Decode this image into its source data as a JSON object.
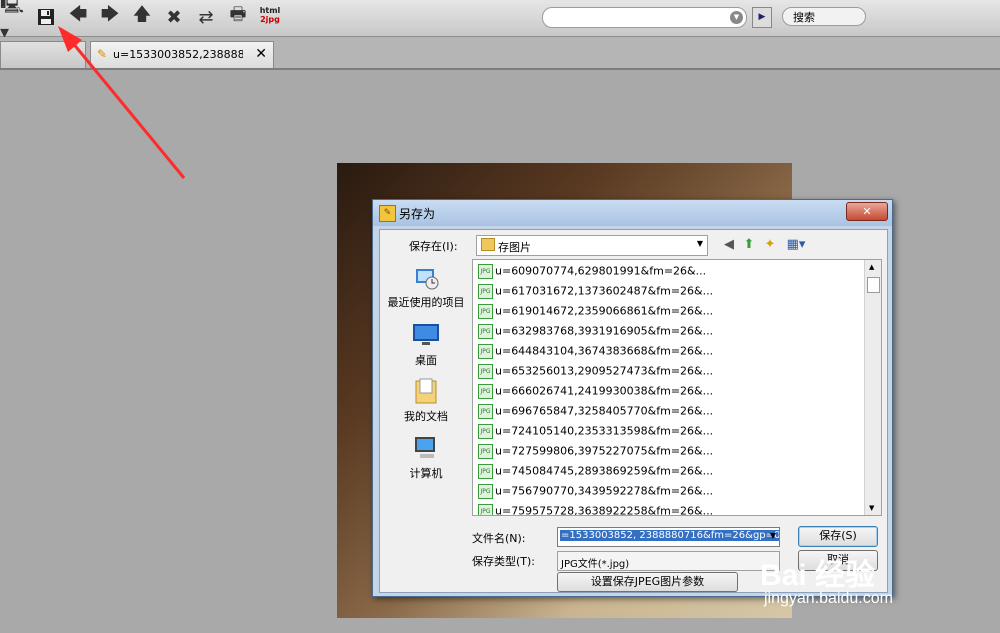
{
  "toolbar": {
    "icons": [
      "monitor-icon",
      "save-icon",
      "back-icon",
      "forward-icon",
      "up-icon",
      "stop-icon",
      "refresh-icon",
      "print-icon"
    ],
    "html2jpg_top": "html",
    "html2jpg_bottom": "2jpg",
    "address_value": "",
    "search_label": "搜索"
  },
  "tabs": {
    "active_title": "u=1533003852,2388880716,...",
    "close_glyph": "✕"
  },
  "dialog": {
    "title": "另存为",
    "close_label": "✕",
    "save_in_label": "保存在(I):",
    "save_in_value": "存图片",
    "places": [
      "最近使用的项目",
      "桌面",
      "我的文档",
      "计算机"
    ],
    "files": [
      "u=609070774,629801991&fm=26&...",
      "u=617031672,1373602487&fm=26&...",
      "u=619014672,2359066861&fm=26&...",
      "u=632983768,3931916905&fm=26&...",
      "u=644843104,3674383668&fm=26&...",
      "u=653256013,2909527473&fm=26&...",
      "u=666026741,2419930038&fm=26&...",
      "u=696765847,3258405770&fm=26&...",
      "u=724105140,2353313598&fm=26&...",
      "u=727599806,3975227075&fm=26&...",
      "u=745084745,2893869259&fm=26&...",
      "u=756790770,3439592278&fm=26&...",
      "u=759575728,3638922258&fm=26&..."
    ],
    "file_name_label": "文件名(N):",
    "file_name_value": "=1533003852, 2388880716&fm=26&gp=0. jpg",
    "file_type_label": "保存类型(T):",
    "file_type_value": "JPG文件(*.jpg)",
    "jpeg_param_button": "设置保存JPEG图片参数",
    "save_button": "保存(S)",
    "cancel_button": "取消"
  },
  "watermark": {
    "brand": "Bai 经验",
    "url": "jingyan.baidu.com"
  },
  "colors": {
    "arrow": "#ff2a2a",
    "selection": "#3370c4",
    "dialog_frame": "#c4d5e8"
  }
}
